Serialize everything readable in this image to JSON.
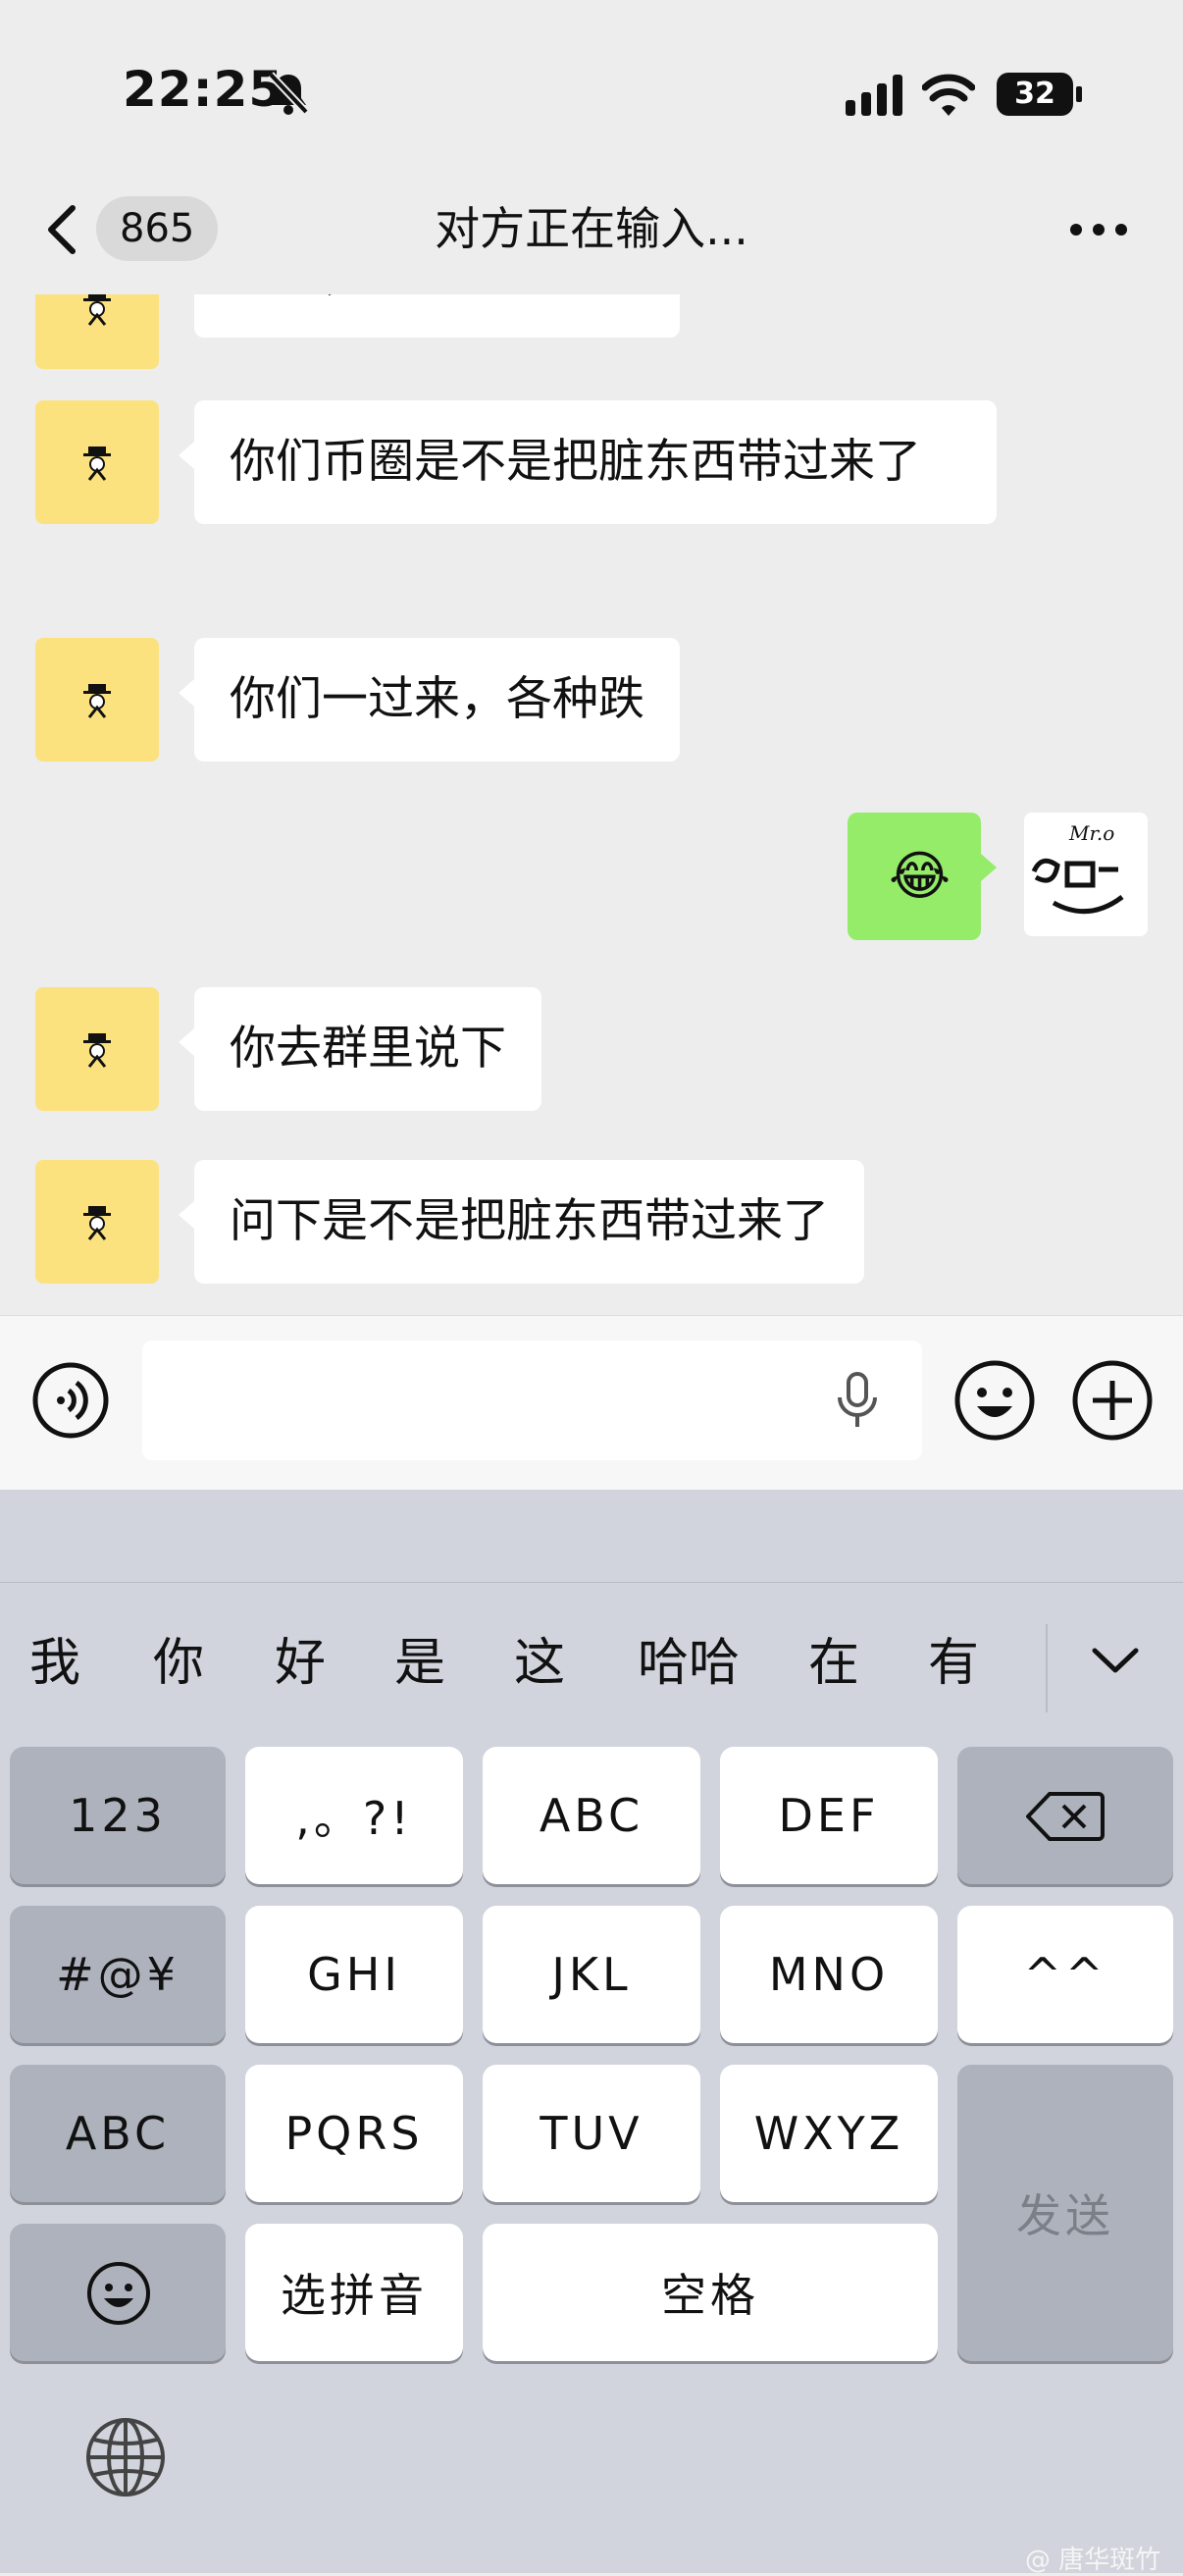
{
  "status_bar": {
    "time": "22:25",
    "battery": "32"
  },
  "nav": {
    "back_count": "865",
    "title": "对方正在输入..."
  },
  "chat": {
    "messages": [
      {
        "from": "other",
        "text": "是的，把毒币过来了"
      },
      {
        "from": "other",
        "text": "你们币圈是不是把脏东西带过来了"
      },
      {
        "from": "other",
        "text": "你们一过来，各种跌"
      },
      {
        "from": "me",
        "text": "😂"
      },
      {
        "from": "other",
        "text": "你去群里说下"
      },
      {
        "from": "other",
        "text": "问下是不是把脏东西带过来了"
      }
    ],
    "my_avatar_text": "Mr.o"
  },
  "input": {
    "placeholder": ""
  },
  "keyboard": {
    "candidates": [
      "我",
      "你",
      "好",
      "是",
      "这",
      "哈哈",
      "在",
      "有"
    ],
    "keys": {
      "num": "123",
      "punct": ",。?!",
      "abc": "ABC",
      "def": "DEF",
      "sym": "#@¥",
      "ghi": "GHI",
      "jkl": "JKL",
      "mno": "MNO",
      "face": "^^",
      "abc_mode": "ABC",
      "pqrs": "PQRS",
      "tuv": "TUV",
      "wxyz": "WXYZ",
      "send": "发送",
      "pinyin": "选拼音",
      "space": "空格"
    }
  },
  "watermark": "@ 唐华斑竹"
}
